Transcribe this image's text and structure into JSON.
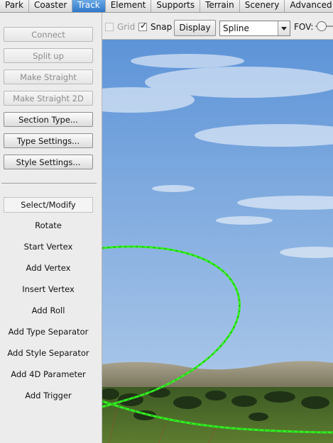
{
  "menu": {
    "tabs": [
      "Park",
      "Coaster",
      "Track",
      "Element",
      "Supports",
      "Terrain",
      "Scenery",
      "Advanced"
    ],
    "active": "Track"
  },
  "sidebar": {
    "connect": "Connect",
    "split_up": "Split up",
    "make_straight": "Make Straight",
    "make_straight_2d": "Make Straight 2D",
    "section_type": "Section Type...",
    "type_settings": "Type Settings...",
    "style_settings": "Style Settings...",
    "tools": {
      "select_modify": "Select/Modify",
      "rotate": "Rotate",
      "start_vertex": "Start Vertex",
      "add_vertex": "Add Vertex",
      "insert_vertex": "Insert Vertex",
      "add_roll": "Add Roll",
      "add_type_separator": "Add Type Separator",
      "add_style_separator": "Add Style Separator",
      "add_4d_parameter": "Add 4D Parameter",
      "add_trigger": "Add Trigger"
    },
    "selected_tool": "Select/Modify"
  },
  "toolbar": {
    "grid_label": "Grid",
    "grid_checked": false,
    "snap_label": "Snap",
    "snap_checked": true,
    "display_label": "Display",
    "curve_select_value": "Spline",
    "fov_label": "FOV:"
  },
  "viewport": {
    "sky_top": "#5d94d8",
    "sky_bottom": "#a9c6e8",
    "track_color": "#33ee22",
    "ground_color": "#4f6b2a"
  }
}
